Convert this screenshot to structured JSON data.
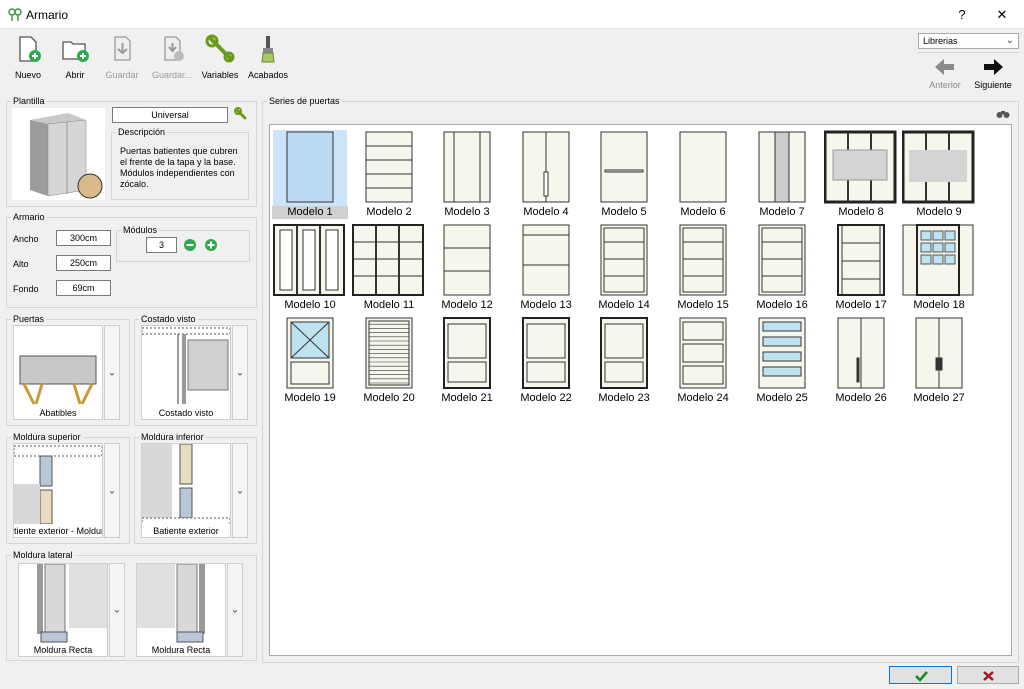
{
  "window": {
    "title": "Armario",
    "help": "?",
    "close": "✕"
  },
  "toolbar": [
    {
      "label": "Nuevo",
      "icon": "new-file-icon",
      "enabled": true
    },
    {
      "label": "Abrir",
      "icon": "open-folder-icon",
      "enabled": true
    },
    {
      "label": "Guardar",
      "icon": "save-icon",
      "enabled": false
    },
    {
      "label": "Guardar...",
      "icon": "save-as-icon",
      "enabled": false
    },
    {
      "label": "Variables",
      "icon": "wrench-icon",
      "enabled": true
    },
    {
      "label": "Acabados",
      "icon": "brush-icon",
      "enabled": true
    }
  ],
  "library": {
    "selected": "Librerias"
  },
  "nav": {
    "prev": "Anterior",
    "next": "Siguiente"
  },
  "plantilla": {
    "legend": "Plantilla",
    "name": "Universal",
    "desc_legend": "Descripción",
    "description": "Puertas batientes que cubren el frente de la tapa y la base. Módulos independientes con zócalo."
  },
  "armario": {
    "legend": "Armario",
    "ancho_label": "Ancho",
    "ancho": "300cm",
    "alto_label": "Alto",
    "alto": "250cm",
    "fondo_label": "Fondo",
    "fondo": "69cm",
    "modulos_legend": "Módulos",
    "modulos": "3"
  },
  "puertas": {
    "legend": "Puertas",
    "value": "Abatibles"
  },
  "costado": {
    "legend": "Costado visto",
    "value": "Costado visto"
  },
  "moldura_sup": {
    "legend": "Moldura superior",
    "value": "tiente exterior - Moldura"
  },
  "moldura_inf": {
    "legend": "Moldura inferior",
    "value": "Batiente exterior"
  },
  "moldura_lat": {
    "legend": "Moldura lateral",
    "value1": "Moldura Recta",
    "value2": "Moldura Recta"
  },
  "series": {
    "legend": "Series de puertas",
    "selected": 0,
    "models": [
      "Modelo 1",
      "Modelo 2",
      "Modelo 3",
      "Modelo 4",
      "Modelo 5",
      "Modelo 6",
      "Modelo 7",
      "Modelo 8",
      "Modelo 9",
      "Modelo 10",
      "Modelo 11",
      "Modelo 12",
      "Modelo 13",
      "Modelo 14",
      "Modelo 15",
      "Modelo 16",
      "Modelo 17",
      "Modelo 18",
      "Modelo 19",
      "Modelo 20",
      "Modelo 21",
      "Modelo 22",
      "Modelo 23",
      "Modelo 24",
      "Modelo 25",
      "Modelo 26",
      "Modelo 27"
    ]
  },
  "footer": {
    "ok": "✔",
    "cancel": "✖"
  },
  "colors": {
    "ok": "#1a8a1a",
    "cancel": "#a01818",
    "selection": "#cce4f7"
  }
}
